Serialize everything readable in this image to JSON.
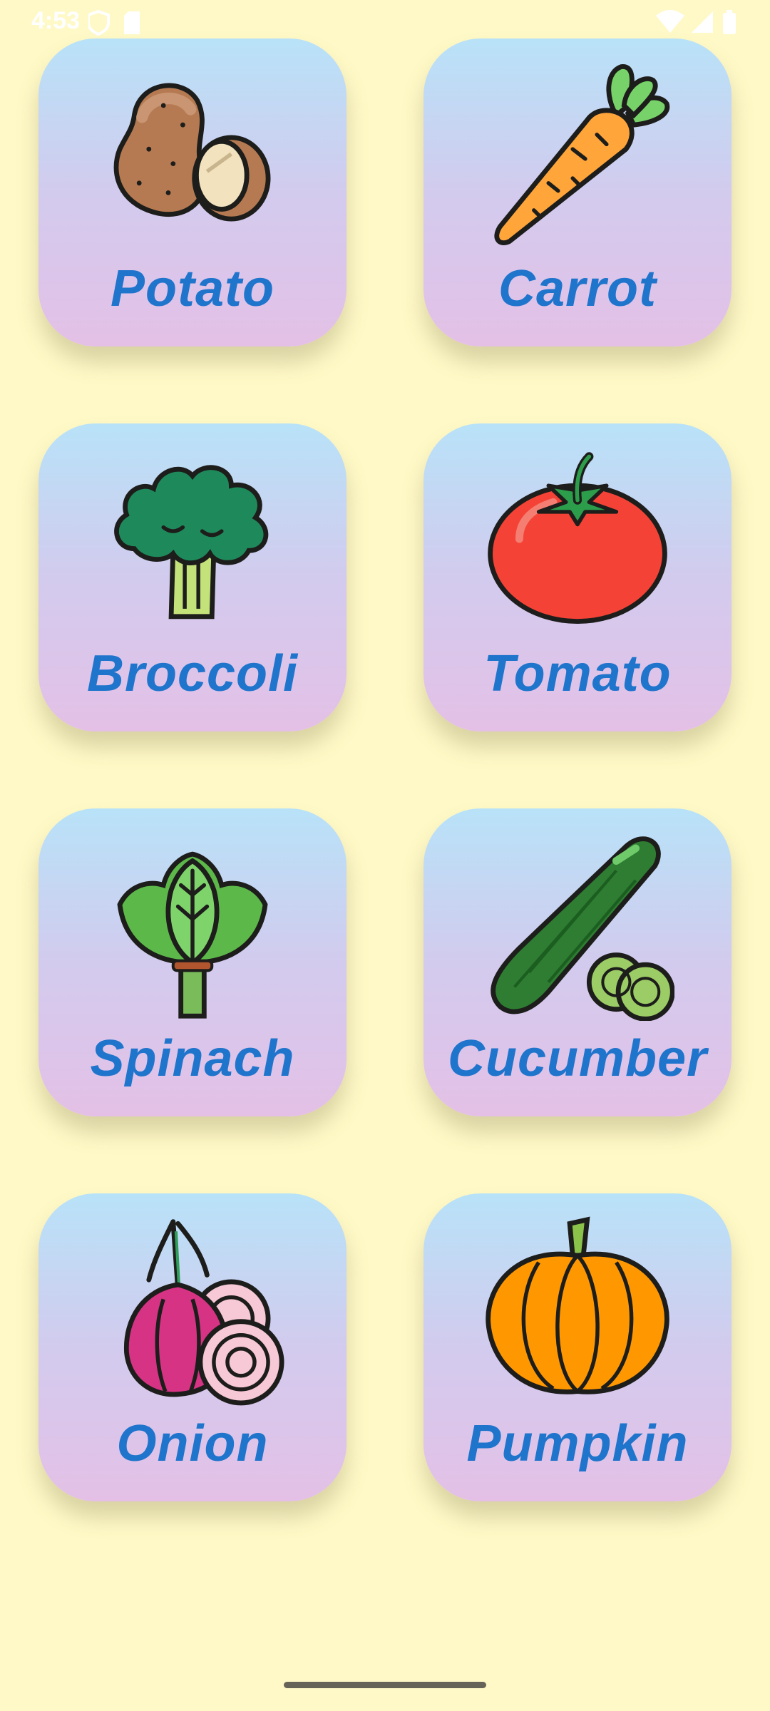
{
  "status_bar": {
    "time": "4:53"
  },
  "vegetables": [
    {
      "name": "Potato",
      "icon": "potato-icon"
    },
    {
      "name": "Carrot",
      "icon": "carrot-icon"
    },
    {
      "name": "Broccoli",
      "icon": "broccoli-icon"
    },
    {
      "name": "Tomato",
      "icon": "tomato-icon"
    },
    {
      "name": "Spinach",
      "icon": "spinach-icon"
    },
    {
      "name": "Cucumber",
      "icon": "cucumber-icon"
    },
    {
      "name": "Onion",
      "icon": "onion-icon"
    },
    {
      "name": "Pumpkin",
      "icon": "pumpkin-icon"
    }
  ],
  "colors": {
    "background": "#FFF9C7",
    "label": "#1F74CC",
    "card_gradient_top": "#B8E2F8",
    "card_gradient_bottom": "#E4C0E6"
  }
}
